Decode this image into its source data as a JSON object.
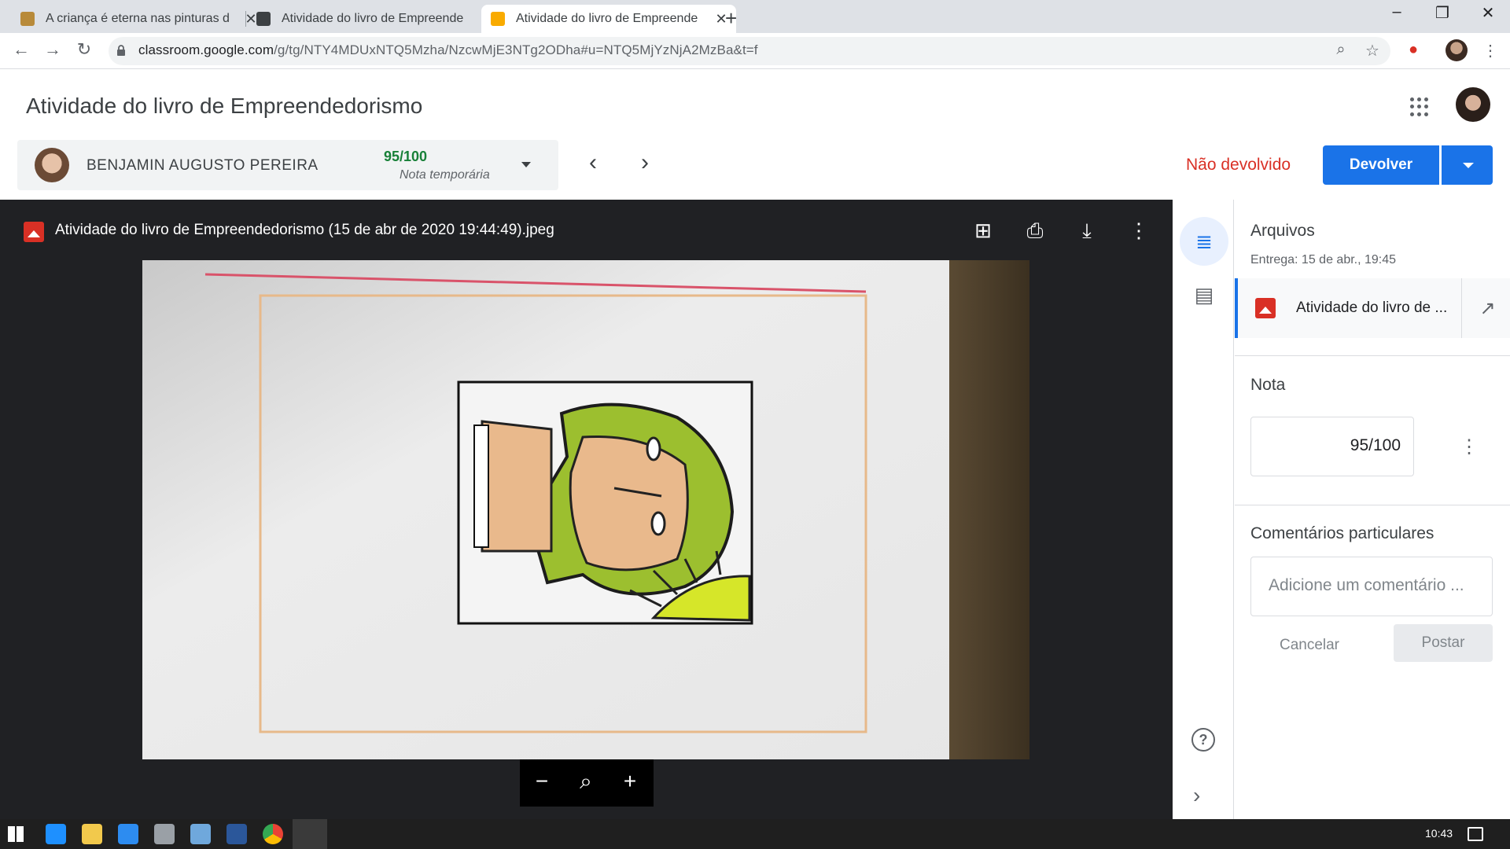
{
  "browser": {
    "tabs": [
      {
        "title": "A criança é eterna nas pinturas d",
        "favicon": "painting-favicon"
      },
      {
        "title": "Atividade do livro de Empreende",
        "favicon": "classroom-favicon"
      },
      {
        "title": "Atividade do livro de Empreende",
        "favicon": "classroom-favicon"
      }
    ],
    "url_host": "classroom.google.com",
    "url_path": "/g/tg/NTY4MDUxNTQ5Mzha/NzcwMjE3NTg2ODha#u=NTQ5MjYzNjA2MzBa&t=f"
  },
  "header": {
    "title": "Atividade do livro de Empreendedorismo"
  },
  "student": {
    "name": "BENJAMIN AUGUSTO PEREIRA",
    "grade": "95/100",
    "grade_note": "Nota temporária"
  },
  "actions": {
    "status": "Não devolvido",
    "return_label": "Devolver"
  },
  "viewer": {
    "file_name": "Atividade do livro de Empreendedorismo (15 de abr de 2020 19:44:49).jpeg"
  },
  "panel": {
    "files_heading": "Arquivos",
    "submitted": "Entrega: 15 de abr., 19:45",
    "attachment": "Atividade do livro de ...",
    "grade_heading": "Nota",
    "grade_value": "95/100",
    "comments_heading": "Comentários particulares",
    "comment_placeholder": "Adicione um comentário ...",
    "cancel_label": "Cancelar",
    "post_label": "Postar"
  },
  "taskbar": {
    "time": "10:43"
  },
  "colors": {
    "accent": "#1a73e8",
    "status_red": "#d93025",
    "grade_green": "#188038",
    "viewer_bg": "#202124"
  }
}
